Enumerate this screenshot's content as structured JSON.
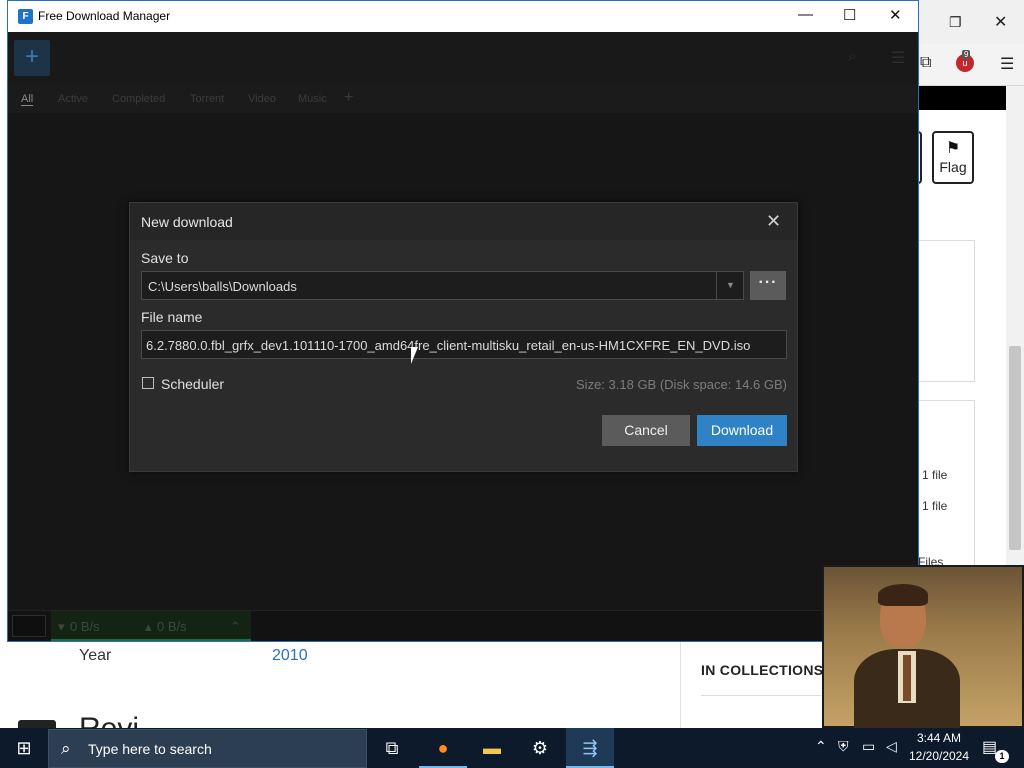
{
  "fdm": {
    "title": "Free Download Manager",
    "logo": "F",
    "add_icon": "plus-icon",
    "tabs": [
      "All",
      "Active",
      "Completed",
      "Torrent",
      "Video",
      "Music"
    ],
    "tab_add": "+",
    "status": {
      "download_speed": "0 B/s",
      "upload_speed": "0 B/s"
    }
  },
  "dialog": {
    "title": "New download",
    "save_to_label": "Save to",
    "save_to_value": "C:\\Users\\balls\\Downloads",
    "browse_label": "···",
    "file_name_label": "File name",
    "file_name_value": "6.2.7880.0.fbl_grfx_dev1.101110-1700_amd64fre_client-multisku_retail_en-us-HM1CXFRE_EN_DVD.iso",
    "scheduler_label": "Scheduler",
    "size_info": "Size: 3.18 GB (Disk space: 14.6 GB)",
    "cancel_label": "Cancel",
    "download_label": "Download"
  },
  "browser": {
    "flag_label": "Flag",
    "extension_badge": "9",
    "file_count_1": "1 file",
    "file_count_2": "1 file",
    "files_partial": "Files",
    "year_label": "Year",
    "year_value": "2010",
    "collections_heading": "IN COLLECTIONS",
    "review_heading_partial": "Revi"
  },
  "taskbar": {
    "search_placeholder": "Type here to search",
    "time": "3:44 AM",
    "date": "12/20/2024",
    "notification_count": "1"
  },
  "colors": {
    "fdm_accent": "#2f82c6",
    "fdm_dark": "#1b1b1b",
    "taskbar_bg": "#0c1a2c",
    "link_blue": "#2b73b7"
  }
}
